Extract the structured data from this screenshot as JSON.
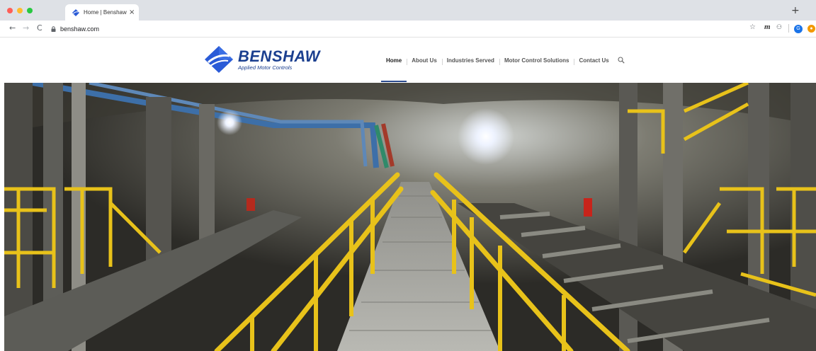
{
  "browser": {
    "tab": {
      "title": "Home | Benshaw | ",
      "favicon": "benshaw-logo-icon"
    },
    "address": {
      "url": "benshaw.com"
    },
    "icons": {
      "back": "back-arrow-icon",
      "forward": "forward-arrow-icon",
      "reload": "reload-icon",
      "star": "bookmark-star-icon",
      "extension_m": "m",
      "profile_initial": "G"
    }
  },
  "site": {
    "logo": {
      "wordmark": "BENSHAW",
      "tagline": "Applied Motor Controls"
    },
    "nav": [
      {
        "label": "Home",
        "active": true
      },
      {
        "label": "About Us",
        "active": false
      },
      {
        "label": "Industries Served",
        "active": false
      },
      {
        "label": "Motor Control Solutions",
        "active": false
      },
      {
        "label": "Contact Us",
        "active": false
      }
    ],
    "colors": {
      "brand_blue": "#1b3f8f",
      "logo_blue": "#2a5bd7",
      "rail_yellow": "#e8c21a"
    }
  },
  "hero": {
    "image": "underground-mine-conveyor-walkway"
  }
}
